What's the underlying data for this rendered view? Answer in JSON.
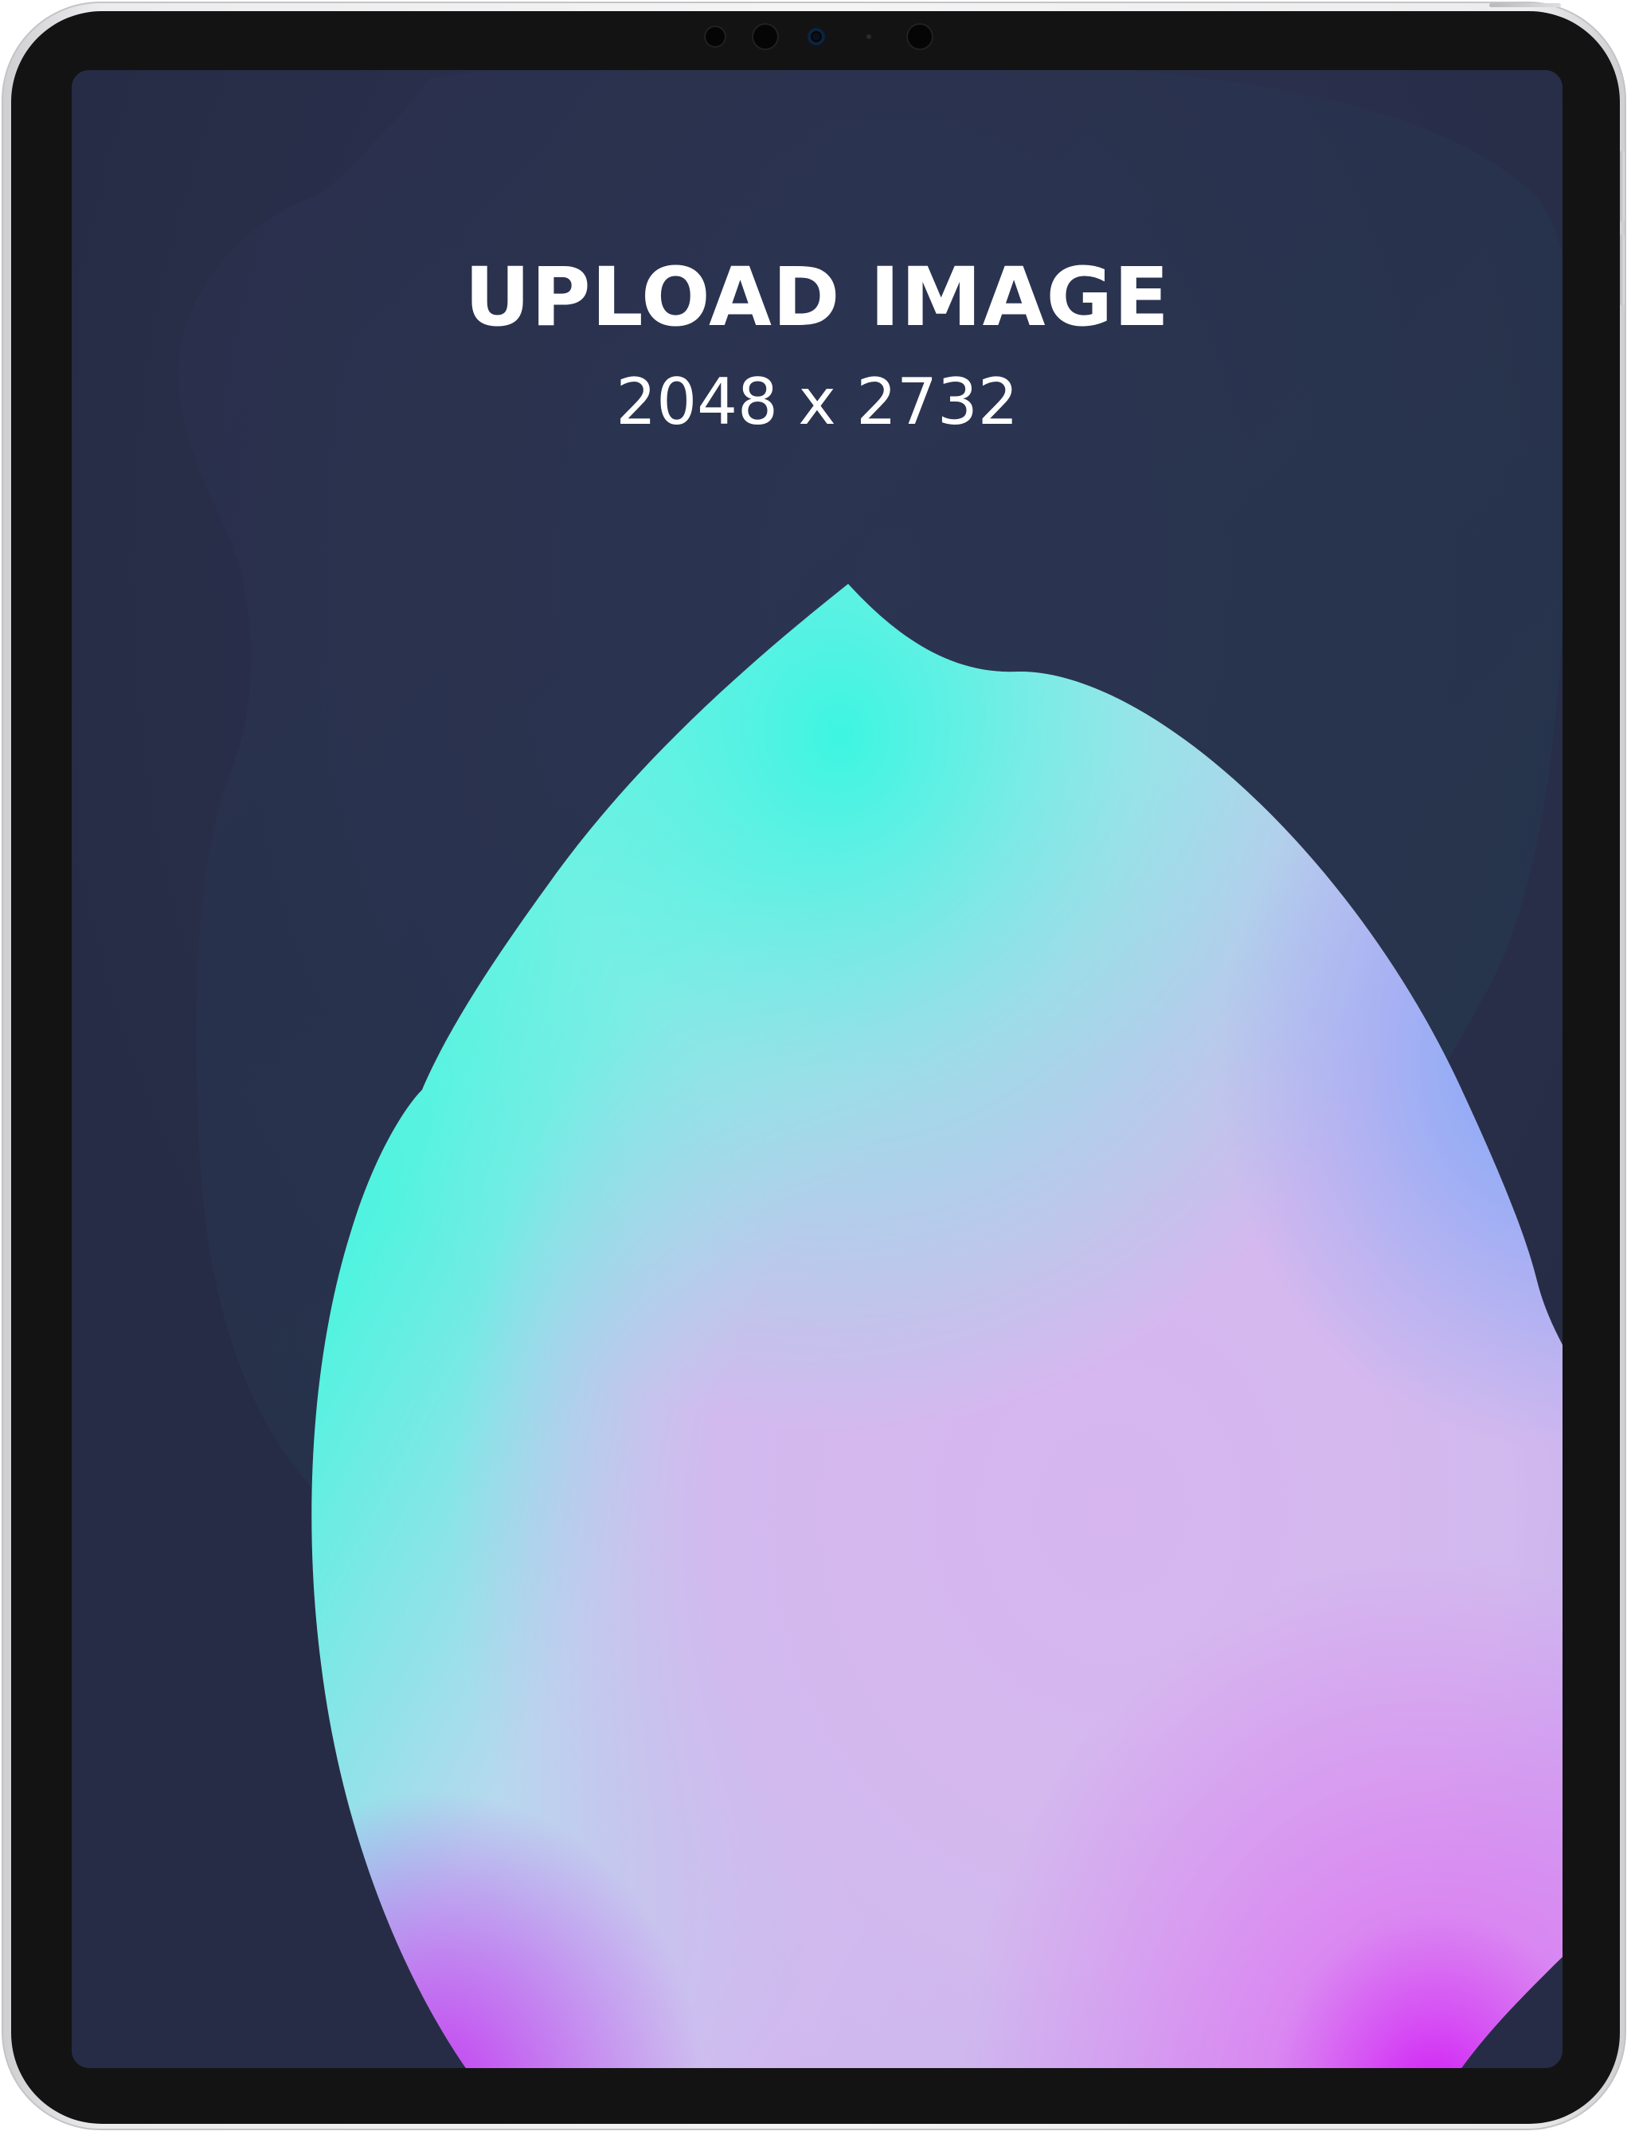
{
  "screen": {
    "title": "UPLOAD IMAGE",
    "subtitle": "2048 x 2732"
  },
  "device": {
    "camera_icons": [
      "camera-lens-icon",
      "camera-lens-icon",
      "camera-sensor-icon",
      "ambient-light-icon",
      "camera-lens-icon"
    ]
  },
  "colors": {
    "screen_background": "#262c45",
    "blob_cyan": "#33f5de",
    "blob_lavender": "#d4b8ef",
    "blob_magenta": "#cc22ee",
    "bezel": "#131313",
    "frame": "#ececee"
  }
}
